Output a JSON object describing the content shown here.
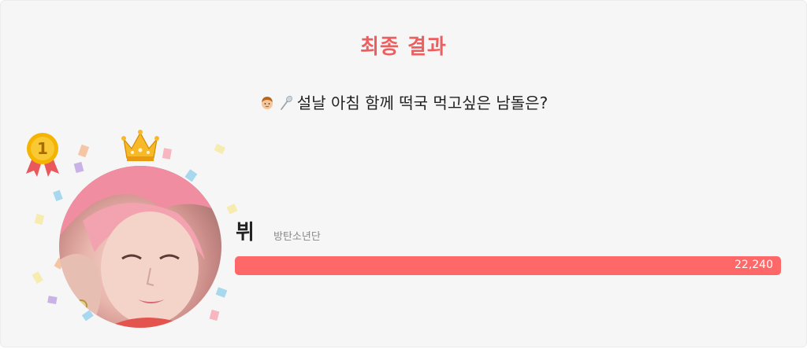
{
  "header": {
    "title": "최종 결과"
  },
  "question": {
    "text": "설날 아침 함께 떡국 먹고싶은 남돌은?",
    "icons": [
      "boy-emoji-icon",
      "spoon-emoji-icon"
    ]
  },
  "winner": {
    "rank": "1",
    "name": "뷔",
    "group": "방탄소년단",
    "votes": "22,240",
    "bar_fill_fraction": 1.0
  },
  "colors": {
    "accent": "#ee5e5e",
    "bar": "#ff6868",
    "card_background": "#f6f6f6"
  }
}
